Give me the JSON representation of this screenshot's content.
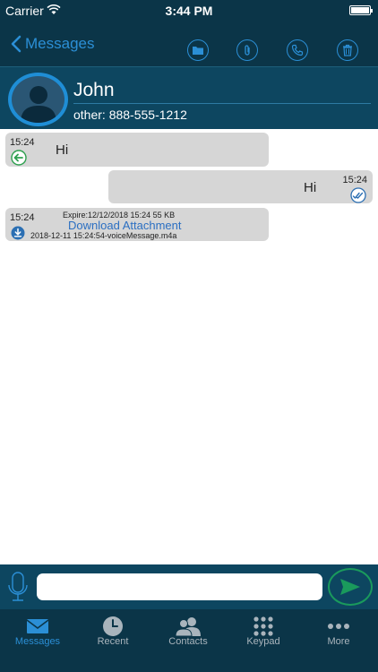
{
  "status_bar": {
    "carrier": "Carrier",
    "time": "3:44 PM"
  },
  "nav": {
    "back_label": "Messages",
    "icons": [
      "folder-icon",
      "paperclip-icon",
      "phone-icon",
      "trash-icon"
    ]
  },
  "contact": {
    "name": "John",
    "phone": "other: 888-555-1212"
  },
  "messages": [
    {
      "direction": "incoming",
      "time": "15:24",
      "text": "Hi"
    },
    {
      "direction": "outgoing",
      "time": "15:24",
      "text": "Hi"
    },
    {
      "direction": "incoming",
      "time": "15:24",
      "meta": "Expire:12/12/2018 15:24 55 KB",
      "link": "Download Attachment",
      "filename": "2018-12-11 15:24:54-voiceMessage.m4a"
    }
  ],
  "input": {
    "value": "",
    "placeholder": ""
  },
  "tabs": [
    {
      "label": "Messages",
      "active": true
    },
    {
      "label": "Recent",
      "active": false
    },
    {
      "label": "Contacts",
      "active": false
    },
    {
      "label": "Keypad",
      "active": false
    },
    {
      "label": "More",
      "active": false
    }
  ],
  "colors": {
    "nav_bg": "#0b3548",
    "header_bg": "#0d4660",
    "accent": "#2b8fd6",
    "bubble": "#d6d6d6",
    "send": "#1a9a5c"
  }
}
